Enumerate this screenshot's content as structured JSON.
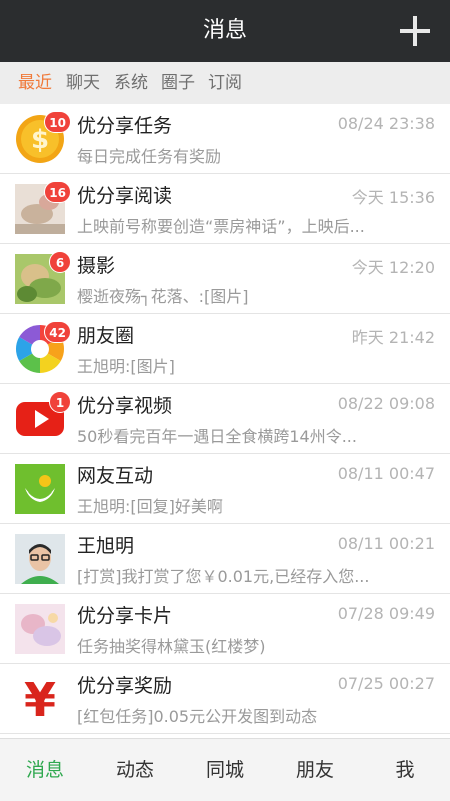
{
  "header": {
    "title": "消息",
    "add_icon": "plus-icon"
  },
  "tabs": [
    {
      "label": "最近",
      "active": true
    },
    {
      "label": "聊天",
      "active": false
    },
    {
      "label": "系统",
      "active": false
    },
    {
      "label": "圈子",
      "active": false
    },
    {
      "label": "订阅",
      "active": false
    }
  ],
  "conversations": [
    {
      "name": "优分享任务",
      "time": "08/24 23:38",
      "preview": "每日完成任务有奖励",
      "badge": "10",
      "avatar": "gold-coin-dollar-icon"
    },
    {
      "name": "优分享阅读",
      "time": "今天 15:36",
      "preview": "上映前号称要创造“票房神话”，上映后...",
      "badge": "16",
      "avatar": "reading-photo"
    },
    {
      "name": "摄影",
      "time": "今天 12:20",
      "preview": "樱逝夜殇┐花落、:[图片]",
      "badge": "6",
      "avatar": "photography-photo"
    },
    {
      "name": "朋友圈",
      "time": "昨天 21:42",
      "preview": "王旭明:[图片]",
      "badge": "42",
      "avatar": "aperture-icon"
    },
    {
      "name": "优分享视频",
      "time": "08/22 09:08",
      "preview": "50秒看完百年一遇日全食横跨14州令...",
      "badge": "1",
      "avatar": "play-video-icon"
    },
    {
      "name": "网友互动",
      "time": "08/11 00:47",
      "preview": "王旭明:[回复]好美啊",
      "badge": "",
      "avatar": "interaction-icon"
    },
    {
      "name": "王旭明",
      "time": "08/11 00:21",
      "preview": "[打赏]我打赏了您￥0.01元,已经存入您...",
      "badge": "",
      "avatar": "user-photo"
    },
    {
      "name": "优分享卡片",
      "time": "07/28 09:49",
      "preview": "任务抽奖得林黛玉(红楼梦)",
      "badge": "",
      "avatar": "card-photo"
    },
    {
      "name": "优分享奖励",
      "time": "07/25 00:27",
      "preview": "[红包任务]0.05元公开发图到动态",
      "badge": "",
      "avatar": "yen-icon"
    }
  ],
  "bottom_nav": [
    {
      "label": "消息",
      "active": true
    },
    {
      "label": "动态",
      "active": false
    },
    {
      "label": "同城",
      "active": false
    },
    {
      "label": "朋友",
      "active": false
    },
    {
      "label": "我",
      "active": false
    }
  ],
  "colors": {
    "accent_tab": "#f07a3a",
    "accent_nav": "#2fa84f",
    "badge": "#f0423a",
    "header_bg": "#2b2d2f"
  }
}
